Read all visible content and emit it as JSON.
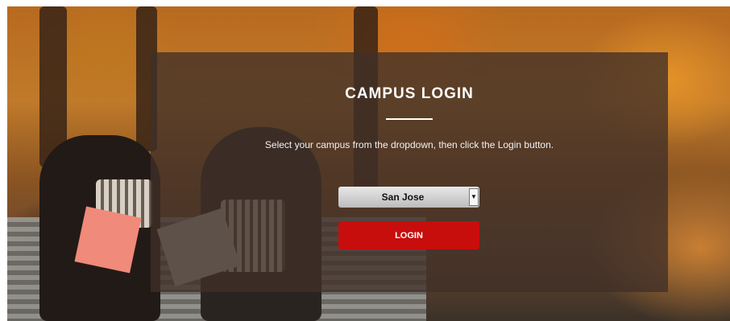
{
  "login": {
    "title": "CAMPUS LOGIN",
    "instructions": "Select your campus from the dropdown, then click the Login button.",
    "campus_select": {
      "selected": "San Jose",
      "arrow_icon": "chevron-down-icon"
    },
    "login_button": "LOGIN"
  },
  "colors": {
    "overlay": "#403028",
    "button": "#c80d0d"
  }
}
